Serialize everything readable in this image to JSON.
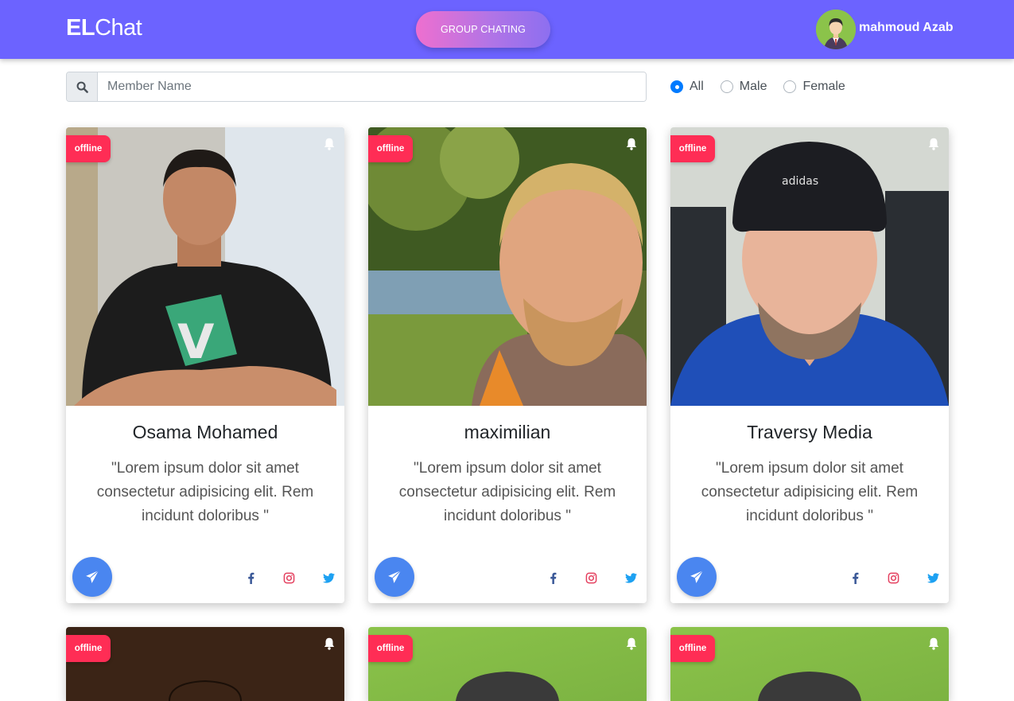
{
  "navbar": {
    "brand_bold": "EL",
    "brand_light": "Chat",
    "group_button": "GROUP CHATING",
    "user_name": "mahmoud Azab"
  },
  "search": {
    "placeholder": "Member Name",
    "value": ""
  },
  "filters": {
    "options": [
      "All",
      "Male",
      "Female"
    ],
    "selected": "All"
  },
  "colors": {
    "navbar": "#6c63ff",
    "badge": "#ff2d55",
    "send_button": "#4a86f0",
    "facebook": "#3b5998",
    "instagram": "#e4405f",
    "twitter": "#1da1f2"
  },
  "cards": [
    {
      "status": "offline",
      "name": "Osama Mohamed",
      "quote": "\"Lorem ipsum dolor sit amet consectetur adipisicing elit. Rem incidunt doloribus \""
    },
    {
      "status": "offline",
      "name": "maximilian",
      "quote": "\"Lorem ipsum dolor sit amet consectetur adipisicing elit. Rem incidunt doloribus \""
    },
    {
      "status": "offline",
      "name": "Traversy Media",
      "quote": "\"Lorem ipsum dolor sit amet consectetur adipisicing elit. Rem incidunt doloribus \""
    },
    {
      "status": "offline",
      "name": "",
      "quote": ""
    },
    {
      "status": "offline",
      "name": "",
      "quote": ""
    },
    {
      "status": "offline",
      "name": "",
      "quote": ""
    }
  ],
  "icons": {
    "search": "search-icon",
    "bell": "bell-icon",
    "send": "paper-plane-icon",
    "facebook": "facebook-icon",
    "instagram": "instagram-icon",
    "twitter": "twitter-icon"
  }
}
